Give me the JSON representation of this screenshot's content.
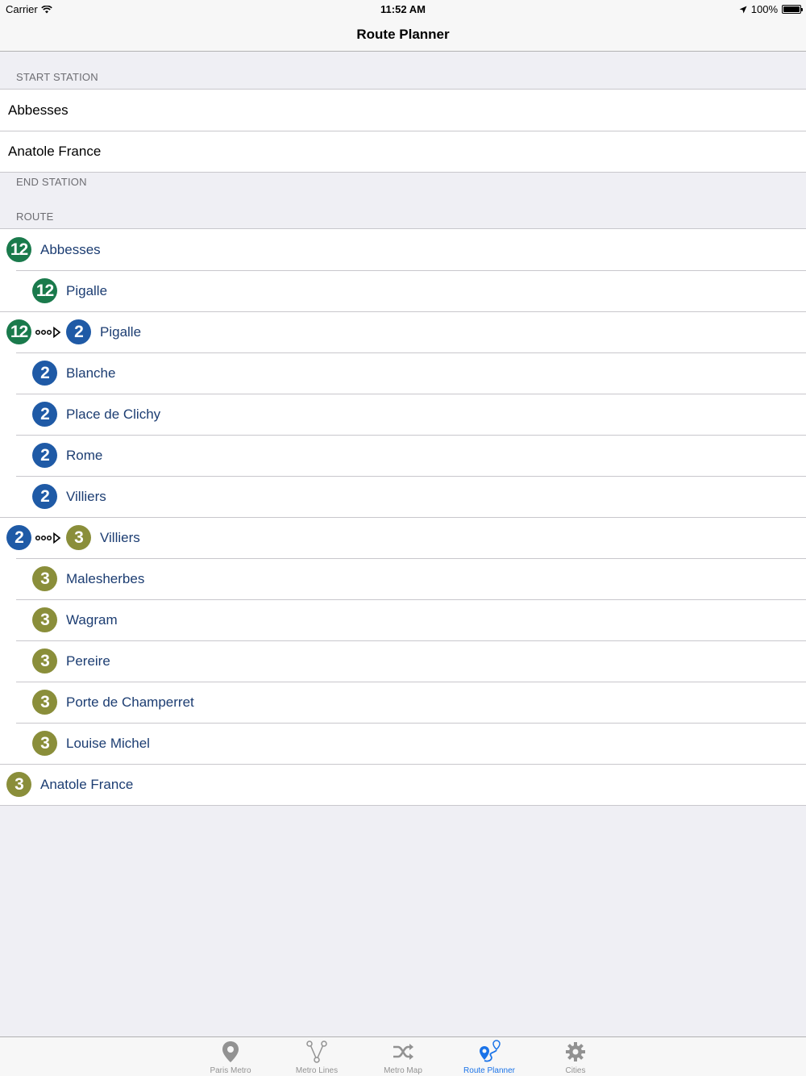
{
  "status_bar": {
    "carrier": "Carrier",
    "time": "11:52 AM",
    "battery": "100%"
  },
  "nav": {
    "title": "Route Planner"
  },
  "sections": {
    "start_header": "START STATION",
    "end_header": "END STATION",
    "route_header": "ROUTE"
  },
  "start_stations": [
    "Abbesses",
    "Anatole France"
  ],
  "lines": {
    "12": {
      "label": "12",
      "color": "#1a7a4c"
    },
    "2": {
      "label": "2",
      "color": "#1f5aa6"
    },
    "3": {
      "label": "3",
      "color": "#8a8e3a"
    }
  },
  "route": [
    {
      "type": "stop",
      "level": 0,
      "line": "12",
      "name": "Abbesses"
    },
    {
      "type": "stop",
      "level": 1,
      "line": "12",
      "name": "Pigalle"
    },
    {
      "type": "transfer",
      "from": "12",
      "to": "2",
      "name": "Pigalle"
    },
    {
      "type": "stop",
      "level": 1,
      "line": "2",
      "name": "Blanche"
    },
    {
      "type": "stop",
      "level": 1,
      "line": "2",
      "name": "Place de Clichy"
    },
    {
      "type": "stop",
      "level": 1,
      "line": "2",
      "name": "Rome"
    },
    {
      "type": "stop",
      "level": 1,
      "line": "2",
      "name": "Villiers"
    },
    {
      "type": "transfer",
      "from": "2",
      "to": "3",
      "name": "Villiers"
    },
    {
      "type": "stop",
      "level": 1,
      "line": "3",
      "name": "Malesherbes"
    },
    {
      "type": "stop",
      "level": 1,
      "line": "3",
      "name": "Wagram"
    },
    {
      "type": "stop",
      "level": 1,
      "line": "3",
      "name": "Pereire"
    },
    {
      "type": "stop",
      "level": 1,
      "line": "3",
      "name": "Porte de Champerret"
    },
    {
      "type": "stop",
      "level": 1,
      "line": "3",
      "name": "Louise Michel"
    },
    {
      "type": "stop",
      "level": 0,
      "line": "3",
      "name": "Anatole France"
    }
  ],
  "tabs": [
    {
      "label": "Paris Metro",
      "icon": "map-pin-icon",
      "active": false
    },
    {
      "label": "Metro Lines",
      "icon": "branch-icon",
      "active": false
    },
    {
      "label": "Metro Map",
      "icon": "shuffle-icon",
      "active": false
    },
    {
      "label": "Route Planner",
      "icon": "route-planner-icon",
      "active": true
    },
    {
      "label": "Cities",
      "icon": "gear-icon",
      "active": false
    }
  ],
  "colors": {
    "accent": "#1a73e8",
    "route_text": "#1c3d72",
    "background": "#efeff4"
  }
}
